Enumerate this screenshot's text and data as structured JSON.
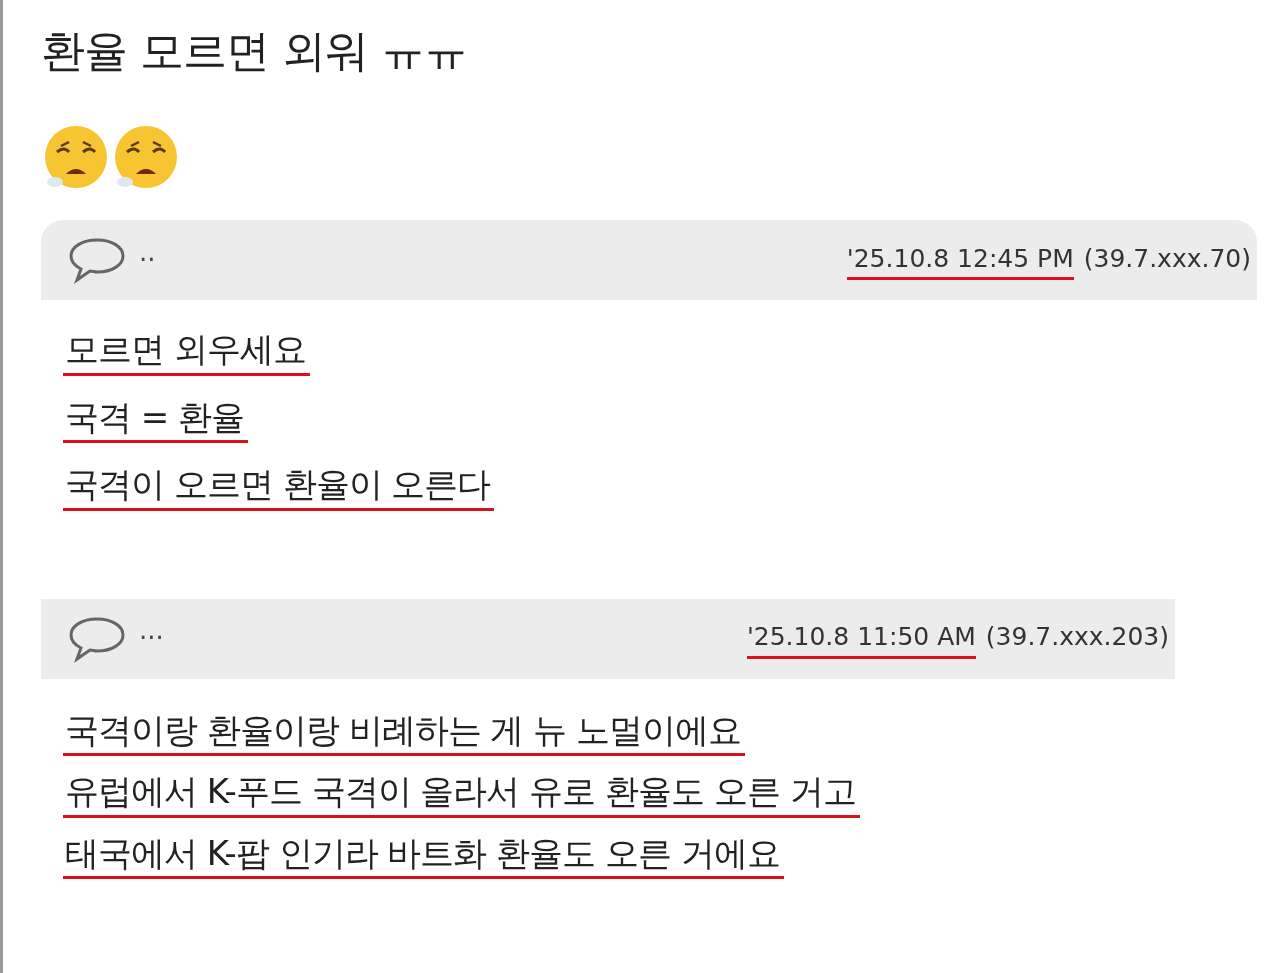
{
  "post": {
    "title": "환율 모르면 외워 ㅠㅠ",
    "emojis": [
      {
        "kind": "tired-face"
      },
      {
        "kind": "tired-face"
      }
    ]
  },
  "comments": [
    {
      "author": "··",
      "date": "'25.10.8 12:45 PM",
      "date_underlined": true,
      "ip": "(39.7.xxx.70)",
      "lines": [
        {
          "text": "모르면 외우세요",
          "underlined": true
        },
        {
          "text": "국격 = 환율",
          "underlined": true
        },
        {
          "text": "국격이 오르면 환율이 오른다",
          "underlined": true
        }
      ]
    },
    {
      "author": "···",
      "date": "'25.10.8 11:50 AM",
      "date_underlined": true,
      "ip": "(39.7.xxx.203)",
      "lines": [
        {
          "text": "국격이랑 환율이랑 비례하는 게 뉴 노멀이에요",
          "underlined": true
        },
        {
          "text": "유럽에서 K-푸드 국격이 올라서 유로 환율도 오른 거고",
          "underlined": true
        },
        {
          "text": "태국에서 K-팝 인기라 바트화 환율도 오른 거에요",
          "underlined": true
        }
      ]
    }
  ]
}
